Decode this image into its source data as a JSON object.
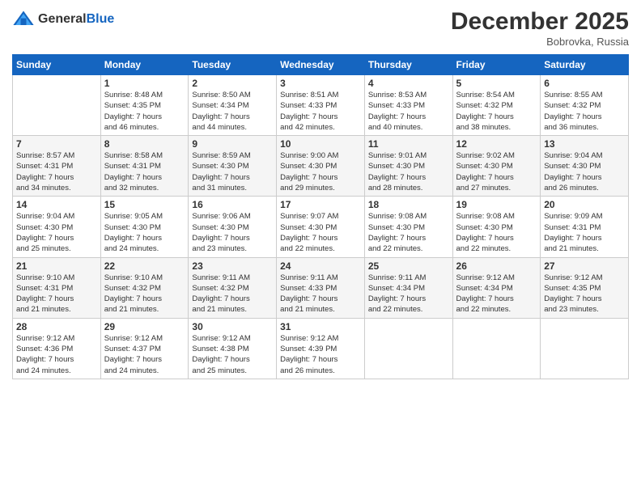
{
  "logo": {
    "general": "General",
    "blue": "Blue"
  },
  "header": {
    "month": "December 2025",
    "location": "Bobrovka, Russia"
  },
  "weekdays": [
    "Sunday",
    "Monday",
    "Tuesday",
    "Wednesday",
    "Thursday",
    "Friday",
    "Saturday"
  ],
  "weeks": [
    [
      {
        "day": "",
        "info": ""
      },
      {
        "day": "1",
        "info": "Sunrise: 8:48 AM\nSunset: 4:35 PM\nDaylight: 7 hours\nand 46 minutes."
      },
      {
        "day": "2",
        "info": "Sunrise: 8:50 AM\nSunset: 4:34 PM\nDaylight: 7 hours\nand 44 minutes."
      },
      {
        "day": "3",
        "info": "Sunrise: 8:51 AM\nSunset: 4:33 PM\nDaylight: 7 hours\nand 42 minutes."
      },
      {
        "day": "4",
        "info": "Sunrise: 8:53 AM\nSunset: 4:33 PM\nDaylight: 7 hours\nand 40 minutes."
      },
      {
        "day": "5",
        "info": "Sunrise: 8:54 AM\nSunset: 4:32 PM\nDaylight: 7 hours\nand 38 minutes."
      },
      {
        "day": "6",
        "info": "Sunrise: 8:55 AM\nSunset: 4:32 PM\nDaylight: 7 hours\nand 36 minutes."
      }
    ],
    [
      {
        "day": "7",
        "info": "Sunrise: 8:57 AM\nSunset: 4:31 PM\nDaylight: 7 hours\nand 34 minutes."
      },
      {
        "day": "8",
        "info": "Sunrise: 8:58 AM\nSunset: 4:31 PM\nDaylight: 7 hours\nand 32 minutes."
      },
      {
        "day": "9",
        "info": "Sunrise: 8:59 AM\nSunset: 4:30 PM\nDaylight: 7 hours\nand 31 minutes."
      },
      {
        "day": "10",
        "info": "Sunrise: 9:00 AM\nSunset: 4:30 PM\nDaylight: 7 hours\nand 29 minutes."
      },
      {
        "day": "11",
        "info": "Sunrise: 9:01 AM\nSunset: 4:30 PM\nDaylight: 7 hours\nand 28 minutes."
      },
      {
        "day": "12",
        "info": "Sunrise: 9:02 AM\nSunset: 4:30 PM\nDaylight: 7 hours\nand 27 minutes."
      },
      {
        "day": "13",
        "info": "Sunrise: 9:04 AM\nSunset: 4:30 PM\nDaylight: 7 hours\nand 26 minutes."
      }
    ],
    [
      {
        "day": "14",
        "info": "Sunrise: 9:04 AM\nSunset: 4:30 PM\nDaylight: 7 hours\nand 25 minutes."
      },
      {
        "day": "15",
        "info": "Sunrise: 9:05 AM\nSunset: 4:30 PM\nDaylight: 7 hours\nand 24 minutes."
      },
      {
        "day": "16",
        "info": "Sunrise: 9:06 AM\nSunset: 4:30 PM\nDaylight: 7 hours\nand 23 minutes."
      },
      {
        "day": "17",
        "info": "Sunrise: 9:07 AM\nSunset: 4:30 PM\nDaylight: 7 hours\nand 22 minutes."
      },
      {
        "day": "18",
        "info": "Sunrise: 9:08 AM\nSunset: 4:30 PM\nDaylight: 7 hours\nand 22 minutes."
      },
      {
        "day": "19",
        "info": "Sunrise: 9:08 AM\nSunset: 4:30 PM\nDaylight: 7 hours\nand 22 minutes."
      },
      {
        "day": "20",
        "info": "Sunrise: 9:09 AM\nSunset: 4:31 PM\nDaylight: 7 hours\nand 21 minutes."
      }
    ],
    [
      {
        "day": "21",
        "info": "Sunrise: 9:10 AM\nSunset: 4:31 PM\nDaylight: 7 hours\nand 21 minutes."
      },
      {
        "day": "22",
        "info": "Sunrise: 9:10 AM\nSunset: 4:32 PM\nDaylight: 7 hours\nand 21 minutes."
      },
      {
        "day": "23",
        "info": "Sunrise: 9:11 AM\nSunset: 4:32 PM\nDaylight: 7 hours\nand 21 minutes."
      },
      {
        "day": "24",
        "info": "Sunrise: 9:11 AM\nSunset: 4:33 PM\nDaylight: 7 hours\nand 21 minutes."
      },
      {
        "day": "25",
        "info": "Sunrise: 9:11 AM\nSunset: 4:34 PM\nDaylight: 7 hours\nand 22 minutes."
      },
      {
        "day": "26",
        "info": "Sunrise: 9:12 AM\nSunset: 4:34 PM\nDaylight: 7 hours\nand 22 minutes."
      },
      {
        "day": "27",
        "info": "Sunrise: 9:12 AM\nSunset: 4:35 PM\nDaylight: 7 hours\nand 23 minutes."
      }
    ],
    [
      {
        "day": "28",
        "info": "Sunrise: 9:12 AM\nSunset: 4:36 PM\nDaylight: 7 hours\nand 24 minutes."
      },
      {
        "day": "29",
        "info": "Sunrise: 9:12 AM\nSunset: 4:37 PM\nDaylight: 7 hours\nand 24 minutes."
      },
      {
        "day": "30",
        "info": "Sunrise: 9:12 AM\nSunset: 4:38 PM\nDaylight: 7 hours\nand 25 minutes."
      },
      {
        "day": "31",
        "info": "Sunrise: 9:12 AM\nSunset: 4:39 PM\nDaylight: 7 hours\nand 26 minutes."
      },
      {
        "day": "",
        "info": ""
      },
      {
        "day": "",
        "info": ""
      },
      {
        "day": "",
        "info": ""
      }
    ]
  ]
}
